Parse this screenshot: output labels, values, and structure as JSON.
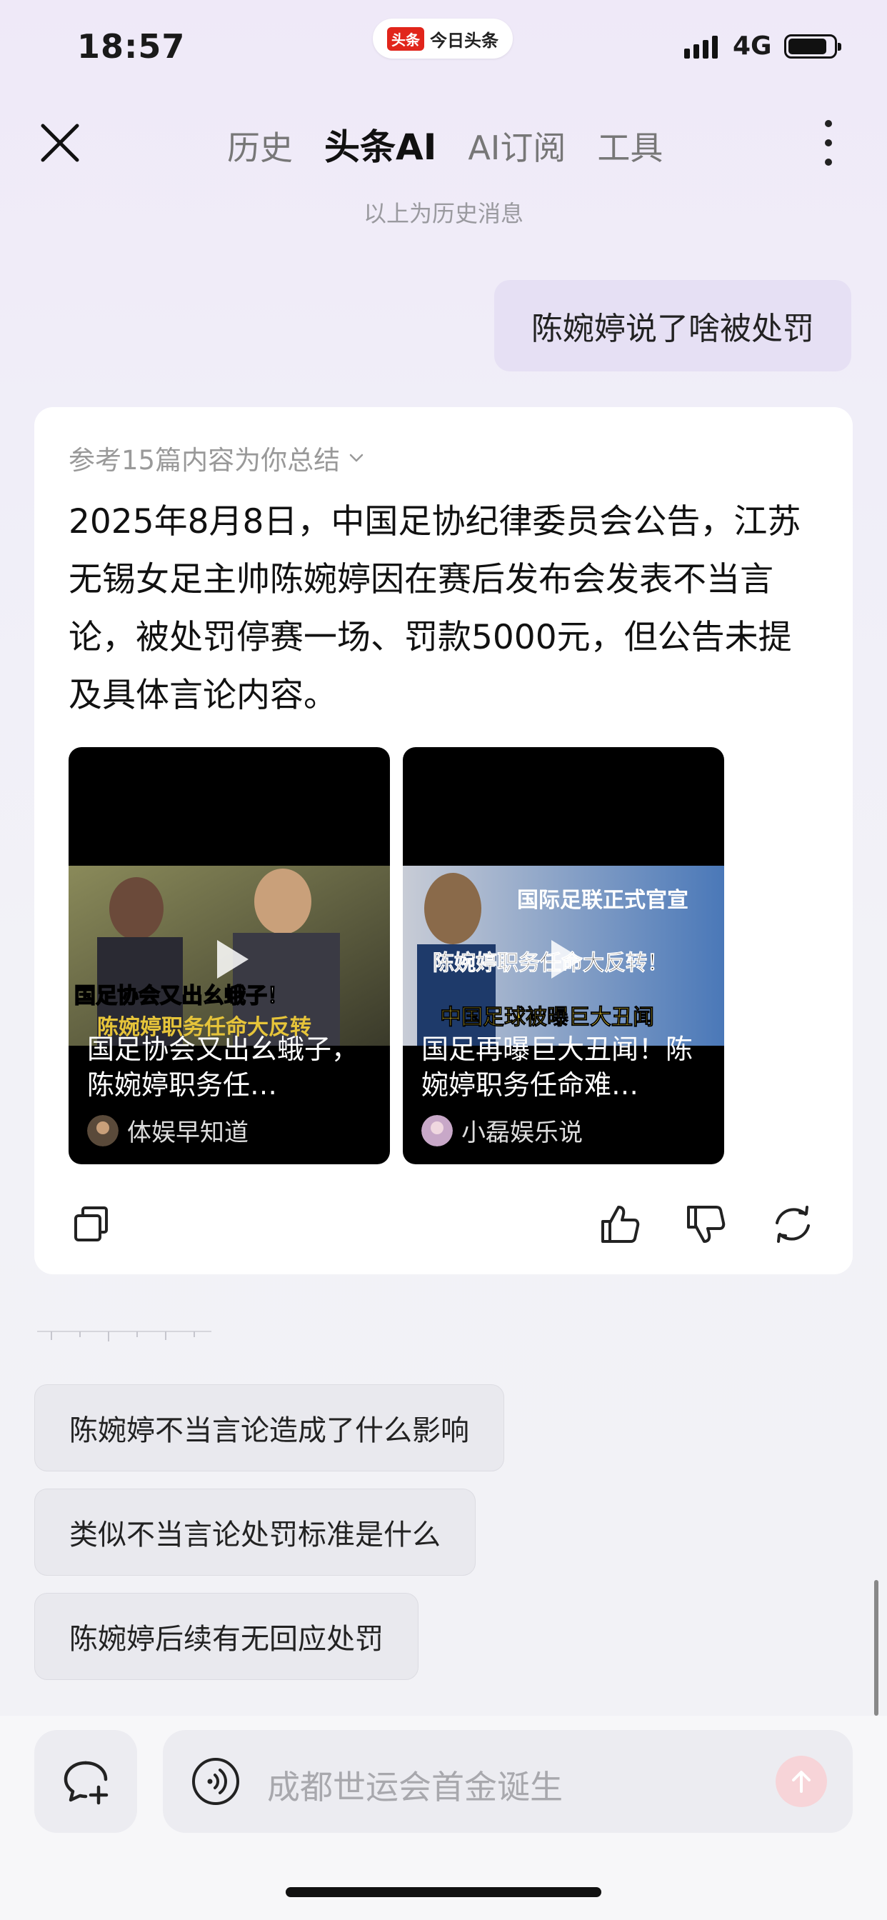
{
  "status_bar": {
    "time": "18:57",
    "app_badge_logo": "头条",
    "app_badge_name": "今日头条",
    "network": "4G"
  },
  "header": {
    "tabs": [
      {
        "label": "历史",
        "active": false
      },
      {
        "label": "头条AI",
        "active": true
      },
      {
        "label": "AI订阅",
        "active": false
      },
      {
        "label": "工具",
        "active": false
      }
    ]
  },
  "history_note": "以上为历史消息",
  "user_message": "陈婉婷说了啥被处罚",
  "answer": {
    "reference_label": "参考15篇内容为你总结",
    "text": "2025年8月8日，中国足协纪律委员会公告，江苏无锡女足主帅陈婉婷因在赛后发布会发表不当言论，被处罚停赛一场、罚款5000元，但公告未提及具体言论内容。",
    "videos": [
      {
        "caption": "国足协会又出幺蛾子，陈婉婷职务任…",
        "source": "体娱早知道",
        "overlay_text": "国足协会又出幺蛾子！",
        "overlay_sub": "陈婉婷职务任命大反转"
      },
      {
        "caption": "国足再曝巨大丑闻！陈婉婷职务任命难…",
        "source": "小磊娱乐说",
        "overlay_text": "国际足联正式官宣",
        "overlay_sub": "陈婉婷职务任命大反转！",
        "overlay_sub2": "中国足球被曝巨大丑闻"
      }
    ]
  },
  "suggestions": [
    "陈婉婷不当言论造成了什么影响",
    "类似不当言论处罚标准是什么",
    "陈婉婷后续有无回应处罚"
  ],
  "input": {
    "placeholder": "成都世运会首金诞生"
  },
  "colors": {
    "accent": "#e1251b",
    "user_bubble": "#e6e0f4",
    "send_disabled": "#f7d4d8"
  }
}
